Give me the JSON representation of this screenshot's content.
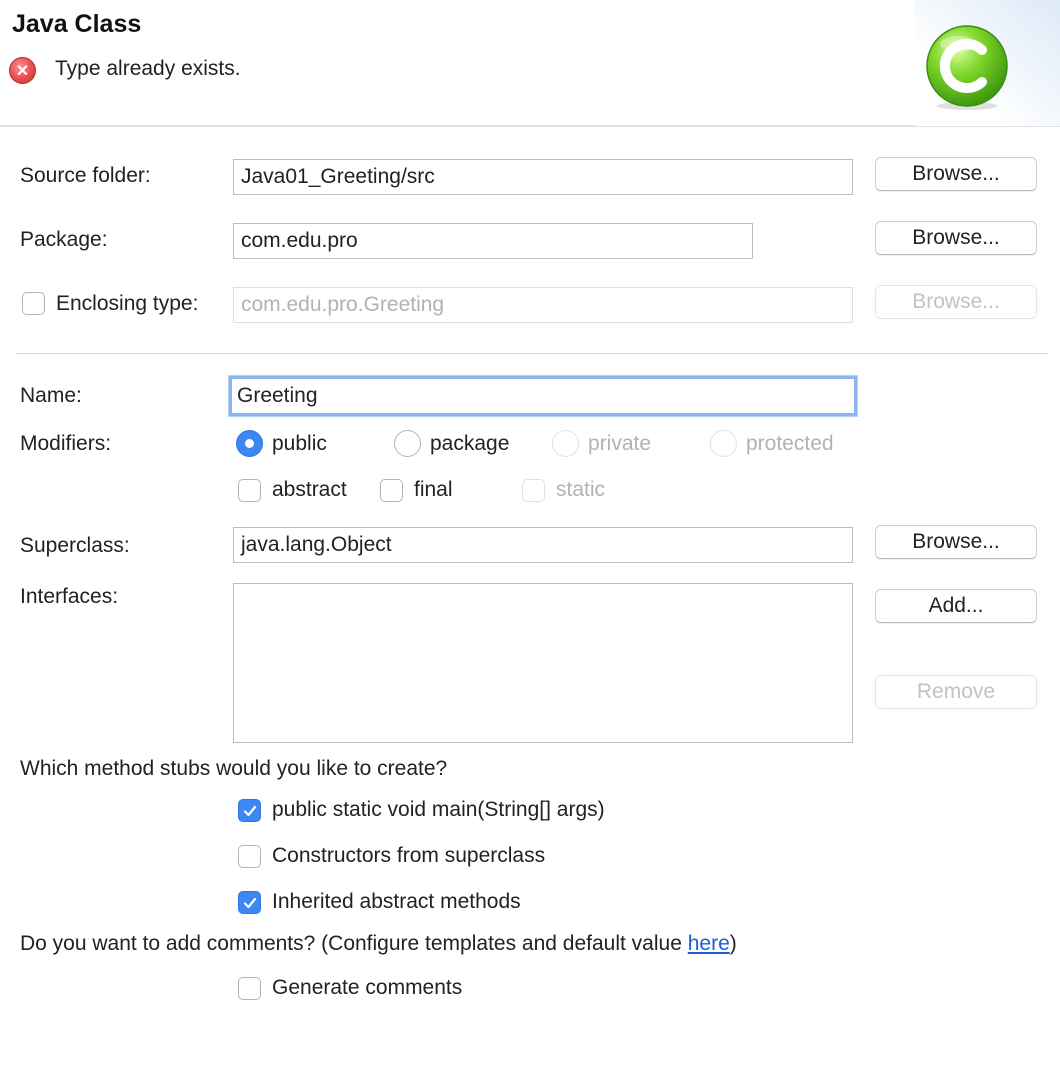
{
  "banner": {
    "title": "Java Class",
    "message": "Type already exists.",
    "error_icon": "error-icon",
    "logo_icon": "java-class-icon"
  },
  "source_folder": {
    "label": "Source folder:",
    "value": "Java01_Greeting/src",
    "button": "Browse..."
  },
  "package": {
    "label": "Package:",
    "value": "com.edu.pro",
    "button": "Browse..."
  },
  "enclosing_type": {
    "label": "Enclosing type:",
    "checked": false,
    "value": "com.edu.pro.Greeting",
    "button": "Browse..."
  },
  "name": {
    "label": "Name:",
    "value": "Greeting"
  },
  "modifiers": {
    "label": "Modifiers:",
    "radios": [
      {
        "label": "public",
        "selected": true,
        "enabled": true
      },
      {
        "label": "package",
        "selected": false,
        "enabled": true
      },
      {
        "label": "private",
        "selected": false,
        "enabled": false
      },
      {
        "label": "protected",
        "selected": false,
        "enabled": false
      }
    ],
    "checkboxes": [
      {
        "label": "abstract",
        "checked": false,
        "enabled": true
      },
      {
        "label": "final",
        "checked": false,
        "enabled": true
      },
      {
        "label": "static",
        "checked": false,
        "enabled": false
      }
    ]
  },
  "superclass": {
    "label": "Superclass:",
    "value": "java.lang.Object",
    "button": "Browse..."
  },
  "interfaces": {
    "label": "Interfaces:",
    "add_button": "Add...",
    "remove_button": "Remove",
    "items": []
  },
  "stubs": {
    "question": "Which method stubs would you like to create?",
    "options": [
      {
        "label": "public static void main(String[] args)",
        "checked": true
      },
      {
        "label": "Constructors from superclass",
        "checked": false
      },
      {
        "label": "Inherited abstract methods",
        "checked": true
      }
    ]
  },
  "comments": {
    "question_prefix": "Do you want to add comments? (Configure templates and default value ",
    "link": "here",
    "question_suffix": ")",
    "option": {
      "label": "Generate comments",
      "checked": false
    }
  },
  "colors": {
    "accent": "#3d87f2",
    "error": "#e84c4c",
    "logo_green": "#5cc21c",
    "link": "#1a5fd0"
  }
}
